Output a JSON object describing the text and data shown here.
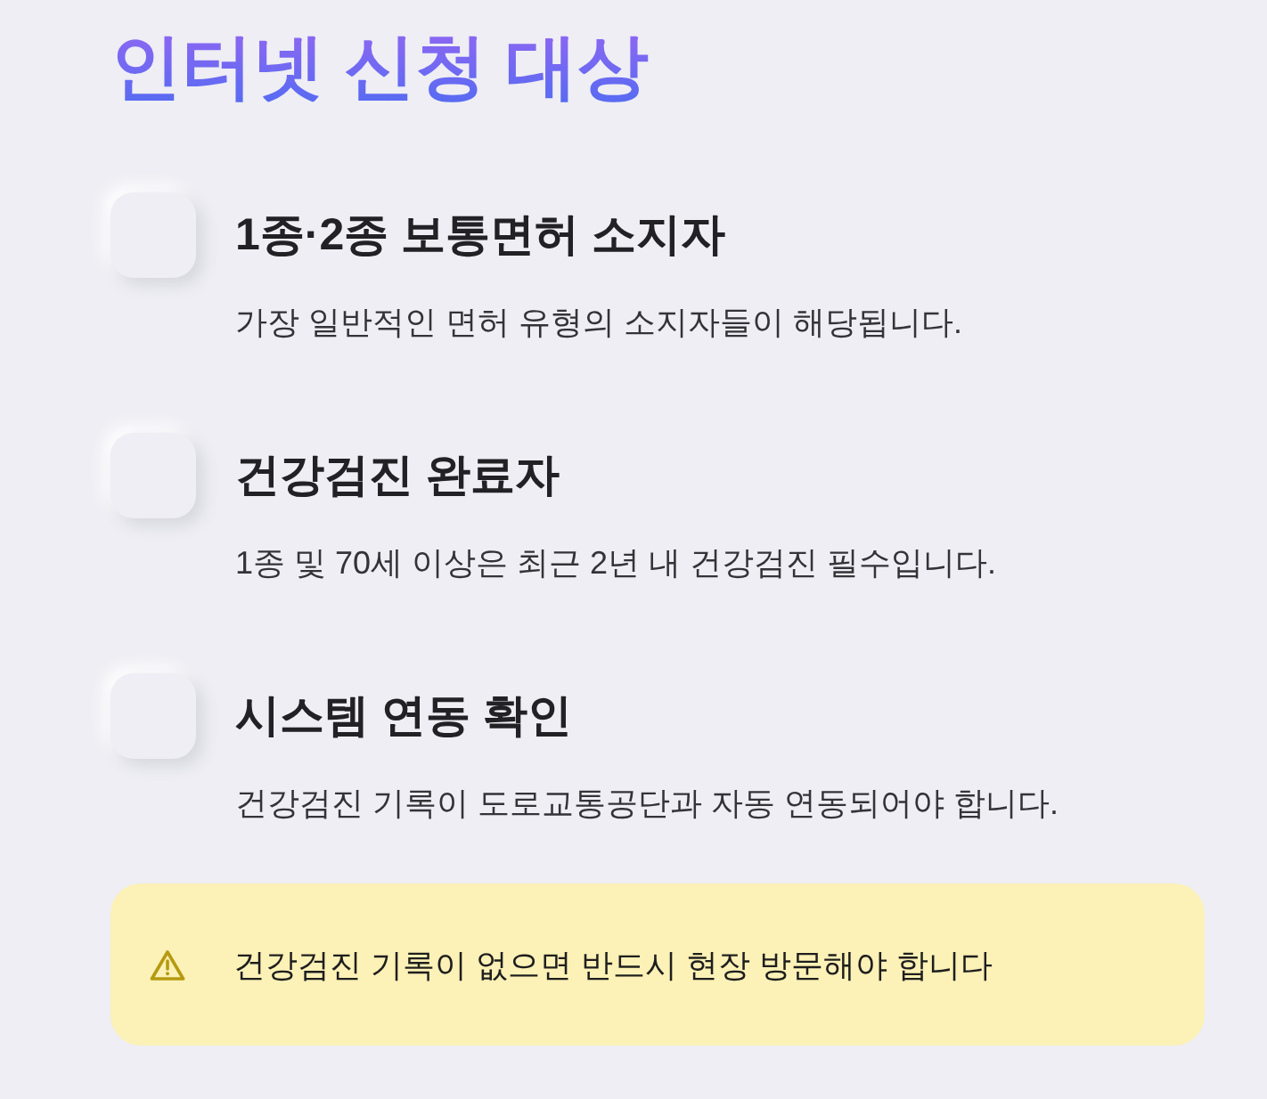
{
  "title": "인터넷 신청 대상",
  "items": [
    {
      "title": "1종·2종 보통면허 소지자",
      "description": "가장 일반적인 면허 유형의 소지자들이 해당됩니다.",
      "checked": false
    },
    {
      "title": "건강검진 완료자",
      "description": "1종 및 70세 이상은 최근 2년 내 건강검진 필수입니다.",
      "checked": false
    },
    {
      "title": "시스템 연동 확인",
      "description": "건강검진 기록이 도로교통공단과 자동 연동되어야 합니다.",
      "checked": false
    }
  ],
  "warning": {
    "text": "건강검진 기록이 없으면 반드시 현장 방문해야 합니다"
  }
}
